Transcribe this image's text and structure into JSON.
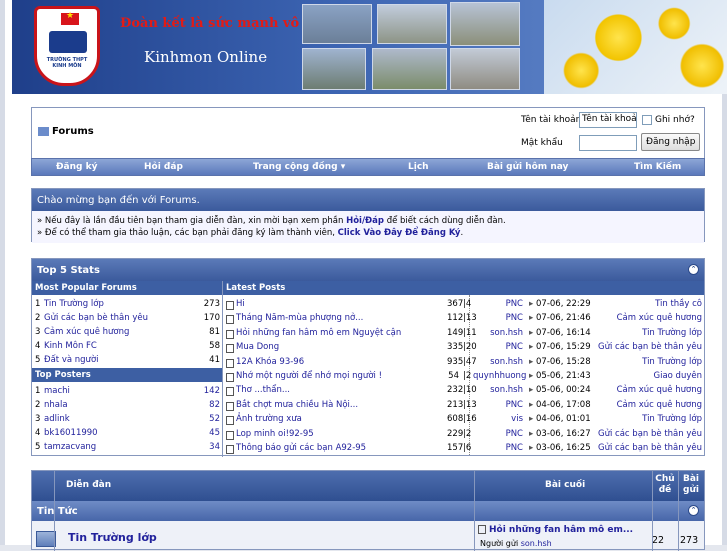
{
  "banner": {
    "slogan": "Đoàn kết là sức mạnh vô địch",
    "site_name": "Kinhmon Online",
    "crest_text": "TRƯỜNG THPT KINH MÔN"
  },
  "login": {
    "forums_label": "Forums",
    "username_label": "Tên tài khoản",
    "username_value": "Tên tài khoản",
    "remember_label": "Ghi nhớ?",
    "password_label": "Mật khẩu",
    "login_button": "Đăng nhập"
  },
  "nav": {
    "items": [
      "Đăng ký",
      "Hỏi đáp",
      "Trang cộng đồng ▾",
      "Lịch",
      "Bài gửi hôm nay",
      "Tìm Kiếm"
    ]
  },
  "notice": {
    "title": "Chào mừng bạn đến với Forums.",
    "line1_pre": "» Nếu đây là lần đầu tiên bạn tham gia diễn đàn, xin mời bạn xem phần ",
    "line1_link": "Hỏi/Đáp",
    "line1_post": " để biết cách dùng diễn đàn.",
    "line2_pre": "» Để có thể tham gia thảo luận, các bạn phải đăng ký làm thành viên, ",
    "line2_link": "Click Vào Đây Để Đăng Ký",
    "line2_post": "."
  },
  "stats": {
    "title": "Top 5 Stats",
    "popular_header": "Most Popular Forums",
    "posters_header": "Top Posters",
    "latest_header": "Latest Posts",
    "popular": [
      {
        "n": "1",
        "name": "Tin Trường lớp",
        "count": "273"
      },
      {
        "n": "2",
        "name": "Gửi các bạn bè thân yêu",
        "count": "170"
      },
      {
        "n": "3",
        "name": "Cảm xúc quê hương",
        "count": "81"
      },
      {
        "n": "4",
        "name": "Kinh Môn FC",
        "count": "58"
      },
      {
        "n": "5",
        "name": "Đất và người",
        "count": "41"
      }
    ],
    "posters": [
      {
        "n": "1",
        "name": "machi",
        "count": "142"
      },
      {
        "n": "2",
        "name": "nhala",
        "count": "82"
      },
      {
        "n": "3",
        "name": "adlink",
        "count": "52"
      },
      {
        "n": "4",
        "name": "bk16011990",
        "count": "45"
      },
      {
        "n": "5",
        "name": "tamzacvang",
        "count": "34"
      }
    ],
    "latest": [
      {
        "title": "Hi",
        "replies": "367",
        "views": "4",
        "user": "PNC",
        "date": "07-06, 22:29",
        "forum": "Tin thầy cô"
      },
      {
        "title": "Tháng Năm-mùa phượng nở...",
        "replies": "112",
        "views": "13",
        "user": "PNC",
        "date": "07-06, 21:46",
        "forum": "Cảm xúc quê hương"
      },
      {
        "title": "Hỏi những fan hâm mô em Nguyệt cận",
        "replies": "149",
        "views": "11",
        "user": "son.hsh",
        "date": "07-06, 16:14",
        "forum": "Tin Trường lớp"
      },
      {
        "title": "Mua Dong",
        "replies": "335",
        "views": "20",
        "user": "PNC",
        "date": "07-06, 15:29",
        "forum": "Gửi các bạn bè thân yêu"
      },
      {
        "title": "12A Khóa 93-96",
        "replies": "935",
        "views": "47",
        "user": "son.hsh",
        "date": "07-06, 15:28",
        "forum": "Tin Trường lớp"
      },
      {
        "title": "Nhớ một người để nhớ mọi người !",
        "replies": "54",
        "views": "2",
        "user": "quynhhuong",
        "date": "05-06, 21:43",
        "forum": "Giao duyên"
      },
      {
        "title": "Thơ ...thẩn...",
        "replies": "232",
        "views": "10",
        "user": "son.hsh",
        "date": "05-06, 00:24",
        "forum": "Cảm xúc quê hương"
      },
      {
        "title": "Bắt chợt mưa chiều Hà Nội...",
        "replies": "213",
        "views": "13",
        "user": "PNC",
        "date": "04-06, 17:08",
        "forum": "Cảm xúc quê hương"
      },
      {
        "title": "Ảnh trường xưa",
        "replies": "608",
        "views": "16",
        "user": "vis",
        "date": "04-06, 01:01",
        "forum": "Tin Trường lớp"
      },
      {
        "title": "Lop minh oi!92-95",
        "replies": "229",
        "views": "2",
        "user": "PNC",
        "date": "03-06, 16:27",
        "forum": "Gửi các bạn bè thân yêu"
      },
      {
        "title": "Thông báo gửi các bạn A92-95",
        "replies": "157",
        "views": "6",
        "user": "PNC",
        "date": "03-06, 16:25",
        "forum": "Gửi các bạn bè thân yêu"
      }
    ]
  },
  "forum_table": {
    "col_forum": "Diễn đàn",
    "col_last": "Bài cuối",
    "col_threads": "Chủ đề",
    "col_posts": "Bài gửi",
    "category": "Tin Tức",
    "row_name": "Tin Trường lớp",
    "row_last_title": "Hỏi những fan hâm mô em...",
    "row_last_by_label": "Người gửi",
    "row_last_by": "son.hsh",
    "row_threads": "22",
    "row_posts": "273"
  }
}
